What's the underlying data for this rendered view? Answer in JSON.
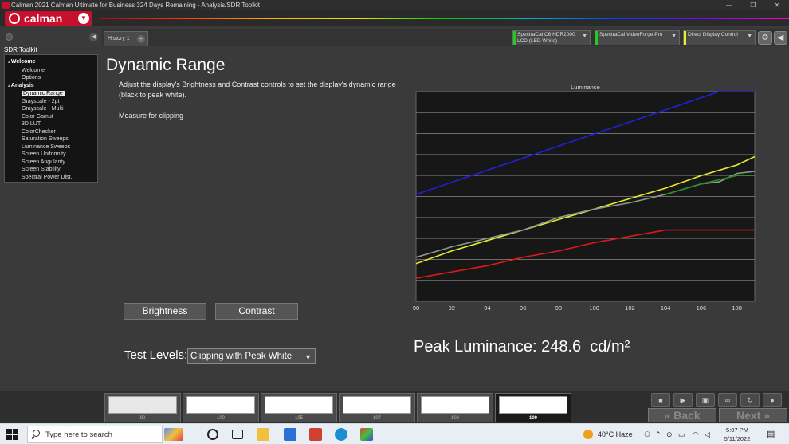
{
  "window": {
    "title": "Calman 2021 Calman Ultimate for Business 324 Days Remaining  - Analysis/SDR Toolkit",
    "buttons": [
      "—",
      "❐",
      "✕"
    ]
  },
  "logo": {
    "text": "calman"
  },
  "sidebar": {
    "title": "SDR Toolkit",
    "tree": [
      {
        "label": "Welcome",
        "kind": "group"
      },
      {
        "label": "Welcome",
        "kind": "child"
      },
      {
        "label": "Options",
        "kind": "child"
      },
      {
        "label": "Analysis",
        "kind": "group"
      },
      {
        "label": "Dynamic Range",
        "kind": "child",
        "selected": true
      },
      {
        "label": "Grayscale - 2pt",
        "kind": "child"
      },
      {
        "label": "Grayscale - Multi",
        "kind": "child"
      },
      {
        "label": "Color Gamut",
        "kind": "child"
      },
      {
        "label": "3D LUT",
        "kind": "child"
      },
      {
        "label": "ColorChecker",
        "kind": "child"
      },
      {
        "label": "Saturation Sweeps",
        "kind": "child"
      },
      {
        "label": "Luminance Sweeps",
        "kind": "child"
      },
      {
        "label": "Screen Uniformity",
        "kind": "child"
      },
      {
        "label": "Screen Angularity",
        "kind": "child"
      },
      {
        "label": "Screen Stability",
        "kind": "child"
      },
      {
        "label": "Spectral Power Dist.",
        "kind": "child"
      }
    ]
  },
  "tabs": {
    "history": "History 1",
    "add": "+"
  },
  "devices": [
    {
      "line1": "SpectraCal C6 HDR2000",
      "line2": "LCD (LED White)",
      "color": "#22cc22"
    },
    {
      "line1": "SpectraCal VideoForge Pro",
      "line2": "",
      "color": "#22cc22"
    },
    {
      "line1": "Direct Display Control",
      "line2": "",
      "color": "#eeee22"
    }
  ],
  "main": {
    "title": "Dynamic Range",
    "instructions": "Adjust the display's Brightness and Contrast controls to set the display's dynamic range (black to peak white).",
    "measure": "Measure for clipping",
    "brightness_label": "Brightness",
    "contrast_label": "Contrast",
    "test_levels_label": "Test Levels:",
    "test_levels_value": "Clipping with Peak White",
    "peak_text": "Peak Luminance: 248.6  cd/m²"
  },
  "chart_data": {
    "type": "line",
    "title": "Luminance",
    "xlim": [
      90,
      109
    ],
    "ylim": [
      0,
      10
    ],
    "xticks": [
      90,
      92,
      94,
      96,
      98,
      100,
      102,
      104,
      106,
      108
    ],
    "grid": true,
    "series": [
      {
        "color": "#2020dd",
        "x": [
          90,
          107,
          109
        ],
        "y": [
          5.1,
          10,
          10
        ]
      },
      {
        "color": "#e8e830",
        "x": [
          90,
          92,
          94,
          96,
          98,
          100,
          102,
          104,
          106,
          108,
          109
        ],
        "y": [
          1.8,
          2.4,
          2.9,
          3.4,
          3.9,
          4.4,
          4.9,
          5.4,
          6.0,
          6.5,
          6.9
        ]
      },
      {
        "color": "#8a9a8a",
        "x": [
          90,
          92,
          94,
          96,
          98,
          100,
          102,
          104,
          106,
          107,
          108,
          109
        ],
        "y": [
          2.1,
          2.6,
          3.0,
          3.4,
          4.0,
          4.4,
          4.7,
          5.1,
          5.6,
          5.7,
          6.1,
          6.2
        ]
      },
      {
        "color": "#2a8a2a",
        "x": [
          104,
          106,
          107,
          108,
          109
        ],
        "y": [
          5.1,
          5.6,
          5.8,
          6.0,
          6.0
        ]
      },
      {
        "color": "#dd1a1a",
        "x": [
          90,
          92,
          94,
          96,
          98,
          100,
          102,
          104,
          105,
          109
        ],
        "y": [
          1.1,
          1.4,
          1.7,
          2.1,
          2.4,
          2.8,
          3.1,
          3.4,
          3.4,
          3.4
        ]
      }
    ]
  },
  "patterns": [
    {
      "label": "90",
      "active": false
    },
    {
      "label": "100",
      "active": false
    },
    {
      "label": "105",
      "active": false
    },
    {
      "label": "107",
      "active": false
    },
    {
      "label": "108",
      "active": false
    },
    {
      "label": "109",
      "active": true
    }
  ],
  "controls": {
    "back": "Back",
    "next": "Next"
  },
  "taskbar": {
    "search_placeholder": "Type here to search",
    "weather": "40°C  Haze",
    "time": "5:07 PM",
    "date": "5/11/2022"
  }
}
